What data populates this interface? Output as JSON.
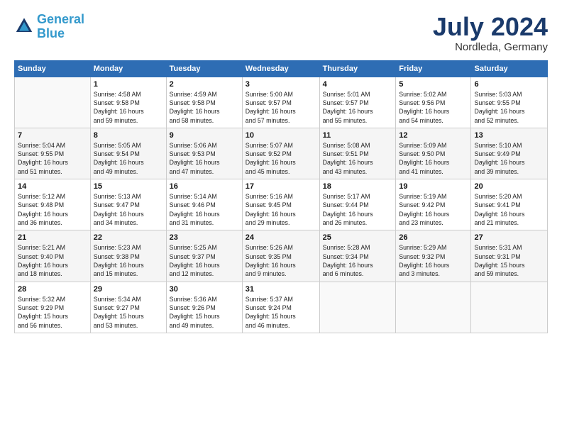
{
  "header": {
    "logo_line1": "General",
    "logo_line2": "Blue",
    "month_title": "July 2024",
    "location": "Nordleda, Germany"
  },
  "weekdays": [
    "Sunday",
    "Monday",
    "Tuesday",
    "Wednesday",
    "Thursday",
    "Friday",
    "Saturday"
  ],
  "weeks": [
    [
      {
        "day": "",
        "info": ""
      },
      {
        "day": "1",
        "info": "Sunrise: 4:58 AM\nSunset: 9:58 PM\nDaylight: 16 hours\nand 59 minutes."
      },
      {
        "day": "2",
        "info": "Sunrise: 4:59 AM\nSunset: 9:58 PM\nDaylight: 16 hours\nand 58 minutes."
      },
      {
        "day": "3",
        "info": "Sunrise: 5:00 AM\nSunset: 9:57 PM\nDaylight: 16 hours\nand 57 minutes."
      },
      {
        "day": "4",
        "info": "Sunrise: 5:01 AM\nSunset: 9:57 PM\nDaylight: 16 hours\nand 55 minutes."
      },
      {
        "day": "5",
        "info": "Sunrise: 5:02 AM\nSunset: 9:56 PM\nDaylight: 16 hours\nand 54 minutes."
      },
      {
        "day": "6",
        "info": "Sunrise: 5:03 AM\nSunset: 9:55 PM\nDaylight: 16 hours\nand 52 minutes."
      }
    ],
    [
      {
        "day": "7",
        "info": "Sunrise: 5:04 AM\nSunset: 9:55 PM\nDaylight: 16 hours\nand 51 minutes."
      },
      {
        "day": "8",
        "info": "Sunrise: 5:05 AM\nSunset: 9:54 PM\nDaylight: 16 hours\nand 49 minutes."
      },
      {
        "day": "9",
        "info": "Sunrise: 5:06 AM\nSunset: 9:53 PM\nDaylight: 16 hours\nand 47 minutes."
      },
      {
        "day": "10",
        "info": "Sunrise: 5:07 AM\nSunset: 9:52 PM\nDaylight: 16 hours\nand 45 minutes."
      },
      {
        "day": "11",
        "info": "Sunrise: 5:08 AM\nSunset: 9:51 PM\nDaylight: 16 hours\nand 43 minutes."
      },
      {
        "day": "12",
        "info": "Sunrise: 5:09 AM\nSunset: 9:50 PM\nDaylight: 16 hours\nand 41 minutes."
      },
      {
        "day": "13",
        "info": "Sunrise: 5:10 AM\nSunset: 9:49 PM\nDaylight: 16 hours\nand 39 minutes."
      }
    ],
    [
      {
        "day": "14",
        "info": "Sunrise: 5:12 AM\nSunset: 9:48 PM\nDaylight: 16 hours\nand 36 minutes."
      },
      {
        "day": "15",
        "info": "Sunrise: 5:13 AM\nSunset: 9:47 PM\nDaylight: 16 hours\nand 34 minutes."
      },
      {
        "day": "16",
        "info": "Sunrise: 5:14 AM\nSunset: 9:46 PM\nDaylight: 16 hours\nand 31 minutes."
      },
      {
        "day": "17",
        "info": "Sunrise: 5:16 AM\nSunset: 9:45 PM\nDaylight: 16 hours\nand 29 minutes."
      },
      {
        "day": "18",
        "info": "Sunrise: 5:17 AM\nSunset: 9:44 PM\nDaylight: 16 hours\nand 26 minutes."
      },
      {
        "day": "19",
        "info": "Sunrise: 5:19 AM\nSunset: 9:42 PM\nDaylight: 16 hours\nand 23 minutes."
      },
      {
        "day": "20",
        "info": "Sunrise: 5:20 AM\nSunset: 9:41 PM\nDaylight: 16 hours\nand 21 minutes."
      }
    ],
    [
      {
        "day": "21",
        "info": "Sunrise: 5:21 AM\nSunset: 9:40 PM\nDaylight: 16 hours\nand 18 minutes."
      },
      {
        "day": "22",
        "info": "Sunrise: 5:23 AM\nSunset: 9:38 PM\nDaylight: 16 hours\nand 15 minutes."
      },
      {
        "day": "23",
        "info": "Sunrise: 5:25 AM\nSunset: 9:37 PM\nDaylight: 16 hours\nand 12 minutes."
      },
      {
        "day": "24",
        "info": "Sunrise: 5:26 AM\nSunset: 9:35 PM\nDaylight: 16 hours\nand 9 minutes."
      },
      {
        "day": "25",
        "info": "Sunrise: 5:28 AM\nSunset: 9:34 PM\nDaylight: 16 hours\nand 6 minutes."
      },
      {
        "day": "26",
        "info": "Sunrise: 5:29 AM\nSunset: 9:32 PM\nDaylight: 16 hours\nand 3 minutes."
      },
      {
        "day": "27",
        "info": "Sunrise: 5:31 AM\nSunset: 9:31 PM\nDaylight: 15 hours\nand 59 minutes."
      }
    ],
    [
      {
        "day": "28",
        "info": "Sunrise: 5:32 AM\nSunset: 9:29 PM\nDaylight: 15 hours\nand 56 minutes."
      },
      {
        "day": "29",
        "info": "Sunrise: 5:34 AM\nSunset: 9:27 PM\nDaylight: 15 hours\nand 53 minutes."
      },
      {
        "day": "30",
        "info": "Sunrise: 5:36 AM\nSunset: 9:26 PM\nDaylight: 15 hours\nand 49 minutes."
      },
      {
        "day": "31",
        "info": "Sunrise: 5:37 AM\nSunset: 9:24 PM\nDaylight: 15 hours\nand 46 minutes."
      },
      {
        "day": "",
        "info": ""
      },
      {
        "day": "",
        "info": ""
      },
      {
        "day": "",
        "info": ""
      }
    ]
  ]
}
